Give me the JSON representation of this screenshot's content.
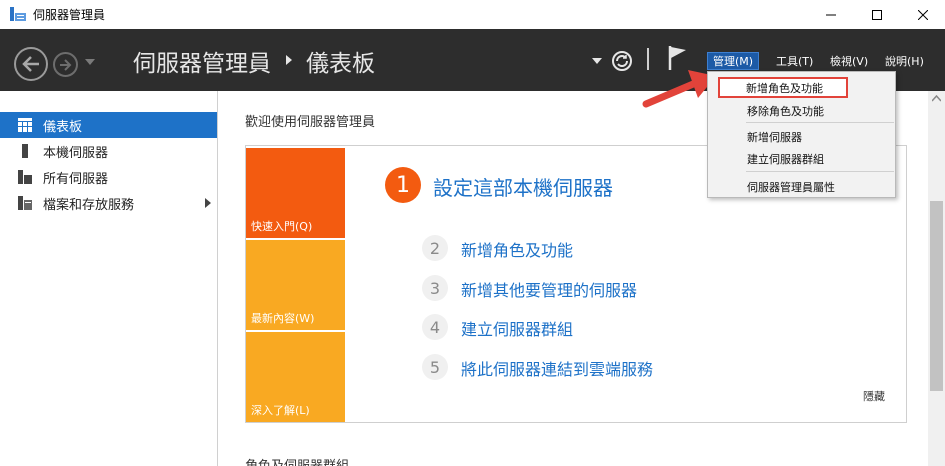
{
  "window": {
    "title": "伺服器管理員",
    "controls": {
      "minimize": "minimize-icon",
      "maximize": "maximize-icon",
      "close": "close-icon"
    }
  },
  "header": {
    "breadcrumb_root": "伺服器管理員",
    "breadcrumb_page": "儀表板",
    "menus": {
      "manage": "管理(M)",
      "tools": "工具(T)",
      "view": "檢視(V)",
      "help": "說明(H)"
    }
  },
  "sidebar": {
    "items": [
      {
        "label": "儀表板",
        "icon": "dashboard-icon",
        "active": true
      },
      {
        "label": "本機伺服器",
        "icon": "local-server-icon",
        "active": false
      },
      {
        "label": "所有伺服器",
        "icon": "all-servers-icon",
        "active": false
      },
      {
        "label": "檔案和存放服務",
        "icon": "file-storage-icon",
        "active": false
      }
    ]
  },
  "main": {
    "welcome_title": "歡迎使用伺服器管理員",
    "tiles": [
      {
        "label": "快速入門(Q)",
        "color": "#f35b10"
      },
      {
        "label": "最新內容(W)",
        "color": "#f9a922"
      },
      {
        "label": "深入了解(L)",
        "color": "#f9a922"
      }
    ],
    "step1": {
      "number": "1",
      "label": "設定這部本機伺服器"
    },
    "steps": [
      {
        "number": "2",
        "label": "新增角色及功能"
      },
      {
        "number": "3",
        "label": "新增其他要管理的伺服器"
      },
      {
        "number": "4",
        "label": "建立伺服器群組"
      },
      {
        "number": "5",
        "label": "將此伺服器連結到雲端服務"
      }
    ],
    "hide_label": "隱藏",
    "roles_heading": "角色及伺服器群組"
  },
  "manage_menu": {
    "items": [
      "新增角色及功能",
      "移除角色及功能",
      "新增伺服器",
      "建立伺服器群組",
      "伺服器管理員屬性"
    ],
    "highlighted_index": 0
  },
  "colors": {
    "header_bg": "#2d2d2d",
    "accent_blue": "#1e72c8",
    "orange": "#f35b10",
    "amber": "#f9a922",
    "highlight_outline": "#e2433a"
  }
}
